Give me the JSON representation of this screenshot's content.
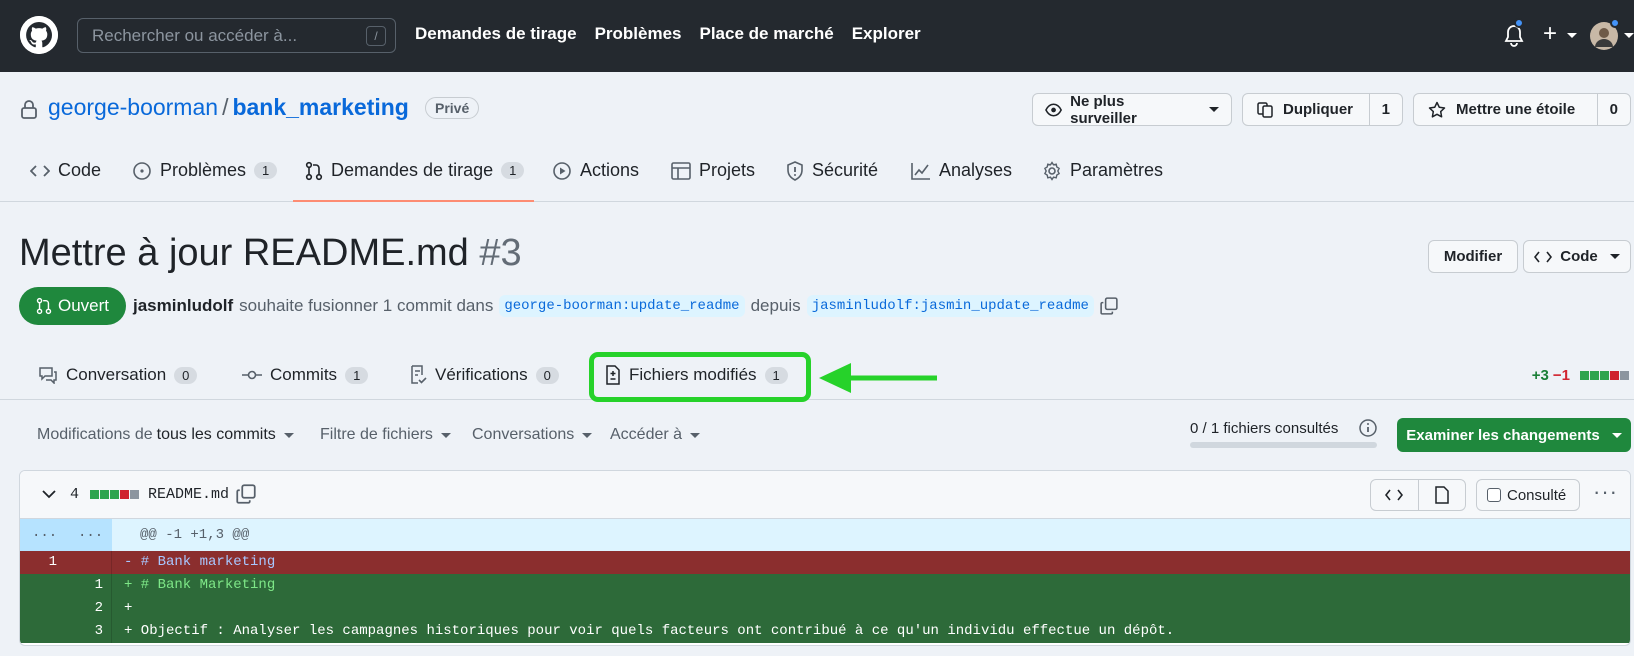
{
  "header": {
    "search_placeholder": "Rechercher ou accéder à...",
    "search_shortcut": "/",
    "nav": [
      "Demandes de tirage",
      "Problèmes",
      "Place de marché",
      "Explorer"
    ],
    "plus_label": "+"
  },
  "repo": {
    "owner": "george-boorman",
    "separator": "/",
    "name": "bank_marketing",
    "visibility": "Privé",
    "watch_label": "Ne plus surveiller",
    "fork_label": "Dupliquer",
    "fork_count": "1",
    "star_label": "Mettre une étoile",
    "star_count": "0"
  },
  "repo_tabs": [
    {
      "label": "Code",
      "icon": "code-icon"
    },
    {
      "label": "Problèmes",
      "count": "1",
      "icon": "issue-icon"
    },
    {
      "label": "Demandes de tirage",
      "count": "1",
      "icon": "pull-request-icon",
      "selected": true
    },
    {
      "label": "Actions",
      "icon": "play-icon"
    },
    {
      "label": "Projets",
      "icon": "table-icon"
    },
    {
      "label": "Sécurité",
      "icon": "shield-icon"
    },
    {
      "label": "Analyses",
      "icon": "graph-icon"
    },
    {
      "label": "Paramètres",
      "icon": "gear-icon"
    }
  ],
  "pr": {
    "title": "Mettre à jour README.md",
    "number": "#3",
    "edit_label": "Modifier",
    "code_label": "Code",
    "state": "Ouvert",
    "author": "jasminludolf",
    "merge_text": "souhaite fusionner 1 commit dans",
    "base_branch": "george-boorman:update_readme",
    "from_text": "depuis",
    "head_branch": "jasminludolf:jasmin_update_readme"
  },
  "pr_tabs": [
    {
      "label": "Conversation",
      "count": "0",
      "icon": "comment-icon"
    },
    {
      "label": "Commits",
      "count": "1",
      "icon": "commit-icon"
    },
    {
      "label": "Vérifications",
      "count": "0",
      "icon": "checklist-icon"
    },
    {
      "label": "Fichiers modifiés",
      "count": "1",
      "icon": "file-diff-icon",
      "highlighted": true
    }
  ],
  "diffstat": {
    "additions": "+3",
    "deletions": "−1"
  },
  "toolbar": {
    "changes_prefix": "Modifications de",
    "changes_value": "tous les commits",
    "file_filter": "Filtre de fichiers",
    "conversations": "Conversations",
    "jump_to": "Accéder à",
    "viewed_text": "0 / 1 fichiers consultés",
    "viewed_fraction": 0,
    "review_label": "Examiner les changements"
  },
  "file": {
    "changes": "4",
    "name": "README.md",
    "viewed_label": "Consulté",
    "hunk_left": "...",
    "hunk_right": "...",
    "hunk": "@@ -1 +1,3 @@",
    "lines": [
      {
        "type": "del",
        "old": "1",
        "new": "",
        "text": "- # Bank marketing"
      },
      {
        "type": "add",
        "old": "",
        "new": "1",
        "text": "+ # Bank Marketing"
      },
      {
        "type": "add",
        "old": "",
        "new": "2",
        "text": "+"
      },
      {
        "type": "add",
        "old": "",
        "new": "3",
        "text": "+ Objectif : Analyser les campagnes historiques pour voir quels facteurs ont contribué à ce qu'un individu effectue un dépôt."
      }
    ]
  },
  "colors": {
    "header_bg": "#24292f",
    "accent_green": "#1f883d",
    "highlight_green": "#26d22a",
    "link_blue": "#0969da",
    "deletion_red": "#8b2e2e",
    "addition_green": "#2d6a39"
  }
}
